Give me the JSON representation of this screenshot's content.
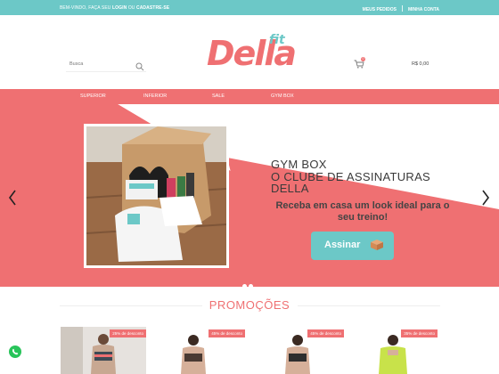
{
  "topbar": {
    "welcome_prefix": "BEM-VINDO, FAÇA SEU",
    "login": "LOGIN",
    "or": "OU",
    "register": "CADASTRE-SE",
    "my_orders": "MEUS PEDIDOS",
    "my_account": "MINHA CONTA"
  },
  "header": {
    "search_placeholder": "Busca",
    "logo_main": "Della",
    "logo_sub": "fit",
    "cart_count": "0",
    "cart_total": "R$ 0,00"
  },
  "nav": {
    "items": [
      "SUPERIOR",
      "INFERIOR",
      "SALE",
      "GYM BOX"
    ]
  },
  "hero": {
    "title_line1": "GYM BOX",
    "title_line2": "O CLUBE DE ASSINATURAS DELLA",
    "subtitle": "Receba em casa um look ideal para o seu treino!",
    "cta_label": "Assinar"
  },
  "promotions": {
    "title": "PROMOÇÕES",
    "items": [
      {
        "discount": "25% de desconto"
      },
      {
        "discount": "45% de desconto"
      },
      {
        "discount": "45% de desconto"
      },
      {
        "discount": "35% de desconto"
      }
    ]
  },
  "colors": {
    "teal": "#6cc8c7",
    "coral": "#ef7072",
    "whatsapp": "#28c45a"
  }
}
